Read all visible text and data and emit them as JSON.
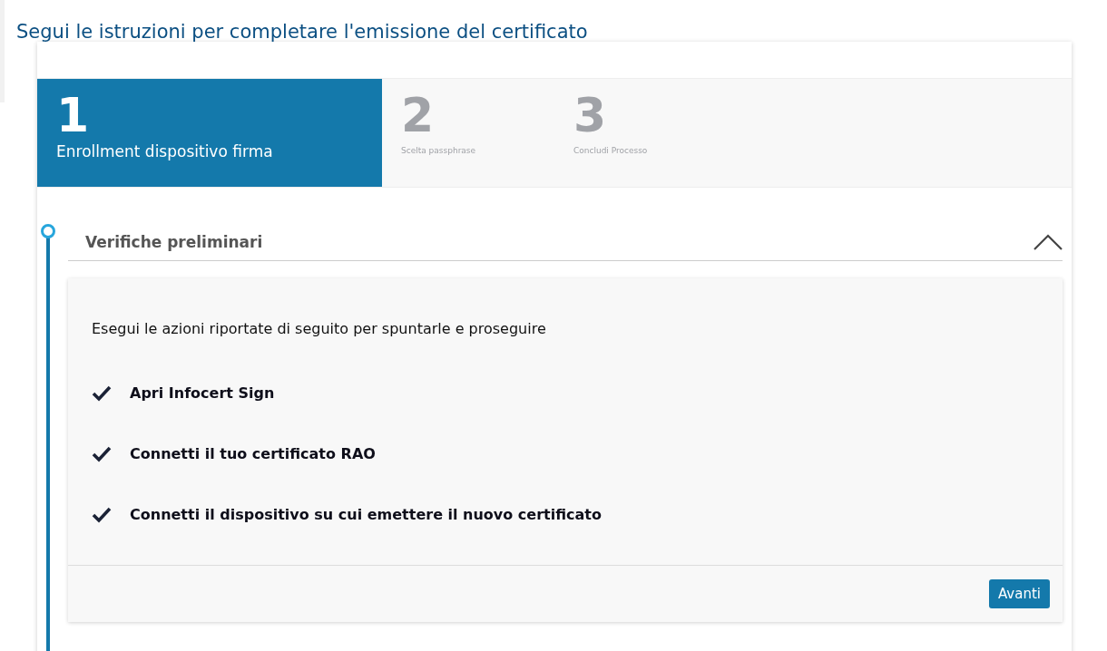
{
  "title": "Segui le istruzioni per completare l'emissione del certificato",
  "steps": [
    {
      "number": "1",
      "label": "Enrollment dispositivo firma",
      "selected": true
    },
    {
      "number": "2",
      "label": "Scelta passphrase",
      "selected": false
    },
    {
      "number": "3",
      "label": "Concludi Processo",
      "selected": false
    }
  ],
  "section": {
    "title": "Verifiche preliminari",
    "expanded": true,
    "intro": "Esegui le azioni riportate di seguito per spuntarle e proseguire",
    "items": [
      {
        "label": "Apri Infocert Sign",
        "checked": true
      },
      {
        "label": "Connetti il tuo certificato RAO",
        "checked": true
      },
      {
        "label": "Connetti il dispositivo su cui emettere il nuovo certificato",
        "checked": true
      }
    ],
    "button": "Avanti"
  }
}
